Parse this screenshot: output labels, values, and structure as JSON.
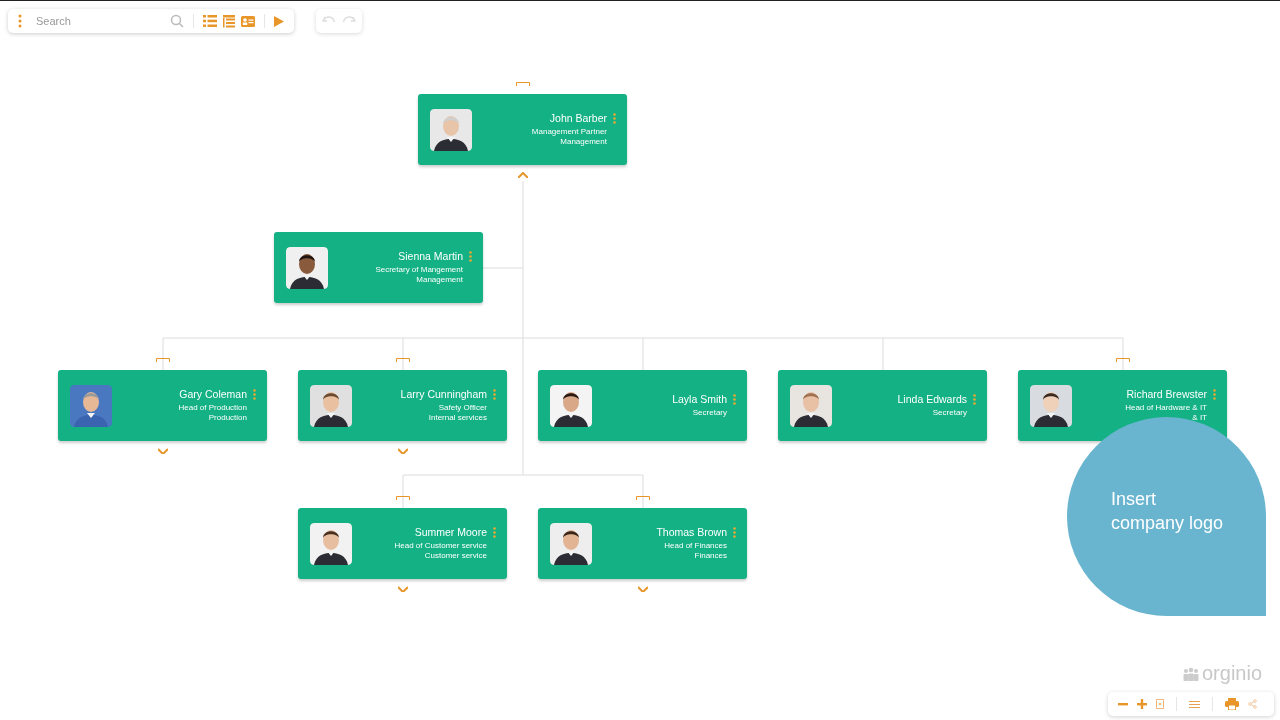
{
  "toolbar": {
    "search": {
      "placeholder": "Search"
    }
  },
  "people": [
    {
      "name": "John Barber",
      "title": "Management Partner",
      "department": "Management",
      "expanded": true
    },
    {
      "name": "Sienna Martin",
      "title": "Secretary of Mangement",
      "department": "Management"
    },
    {
      "name": "Gary Coleman",
      "title": "Head of Production",
      "department": "Production",
      "expanded": false
    },
    {
      "name": "Larry Cunningham",
      "title": "Safety Officer",
      "department": "Internal services",
      "expanded": false
    },
    {
      "name": "Layla Smith",
      "title": "Secretary"
    },
    {
      "name": "Linda Edwards",
      "title": "Secretary"
    },
    {
      "name": "Richard Brewster",
      "title": "Head of Hardware & IT",
      "department": "& IT"
    },
    {
      "name": "Summer Moore",
      "title": "Head of Customer service",
      "department": "Customer service",
      "expanded": false
    },
    {
      "name": "Thomas Brown",
      "title": "Head of Finances",
      "department": "Finances",
      "expanded": false
    }
  ],
  "logo_placeholder": {
    "line_1": "Insert",
    "line_2": "company logo"
  },
  "brand": "orginio"
}
